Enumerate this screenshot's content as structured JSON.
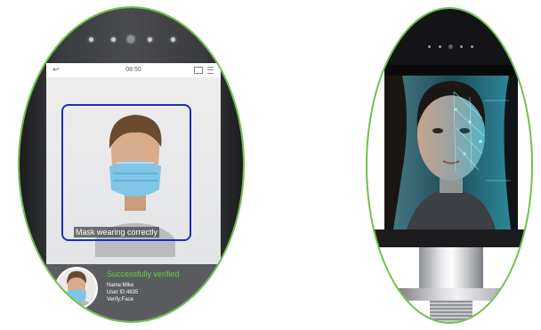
{
  "colors": {
    "oval_border": "#6cc24a",
    "face_frame": "#1c2fb8",
    "success_text": "#5fd13a"
  },
  "left_device": {
    "status_bar": {
      "back_icon": "back-arrow-icon",
      "time": "08:50",
      "right_icons": [
        "tray-icon",
        "menu-icon"
      ]
    },
    "camera": {
      "mask_status": "Mask wearing correctly"
    },
    "verification": {
      "title": "Successfully verified",
      "name": "Name:Mike",
      "user_id": "User ID:4835",
      "verify": "Verify:Face"
    }
  },
  "right_device": {
    "screen": "face-scan-visual"
  }
}
